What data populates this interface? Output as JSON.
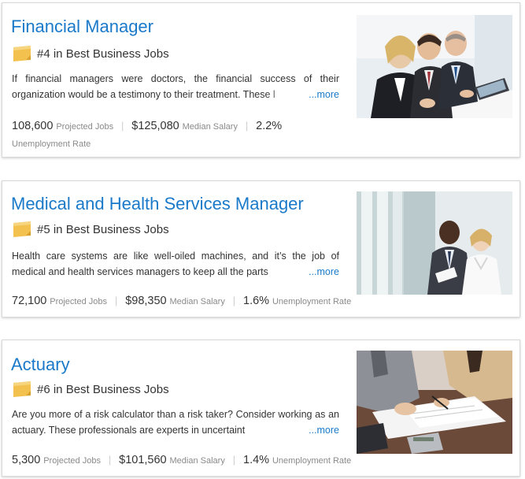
{
  "jobs": [
    {
      "title": "Financial Manager",
      "rank": "#4 in Best Business Jobs",
      "description": "If financial managers were doctors, the financial success of their organization would be a testimony to their treatment. These l",
      "more": "...more",
      "projected_jobs_value": "108,600",
      "projected_jobs_label": "Projected Jobs",
      "median_salary_value": "$125,080",
      "median_salary_label": "Median Salary",
      "unemployment_value": "2.2%",
      "unemployment_label": "Unemployment Rate",
      "photo_icon": "business-meeting-photo"
    },
    {
      "title": "Medical and Health Services Manager",
      "rank": "#5 in Best Business Jobs",
      "description": "Health care systems are like well-oiled machines, and it’s the job of medical and health services managers to keep all the parts",
      "more": "...more",
      "projected_jobs_value": "72,100",
      "projected_jobs_label": "Projected Jobs",
      "median_salary_value": "$98,350",
      "median_salary_label": "Median Salary",
      "unemployment_value": "1.6%",
      "unemployment_label": "Unemployment Rate",
      "photo_icon": "hospital-meeting-photo"
    },
    {
      "title": "Actuary",
      "rank": "#6 in Best Business Jobs",
      "description": "Are you more of a risk calculator than a risk taker? Consider working as an actuary. These professionals are experts in uncertaint",
      "more": "...more",
      "projected_jobs_value": "5,300",
      "projected_jobs_label": "Projected Jobs",
      "median_salary_value": "$101,560",
      "median_salary_label": "Median Salary",
      "unemployment_value": "1.4%",
      "unemployment_label": "Unemployment Rate",
      "photo_icon": "paperwork-calculator-photo"
    }
  ],
  "colors": {
    "link": "#1a7ac9",
    "text": "#333333",
    "muted": "#8a8a8a",
    "badge": "#f2c14e"
  }
}
